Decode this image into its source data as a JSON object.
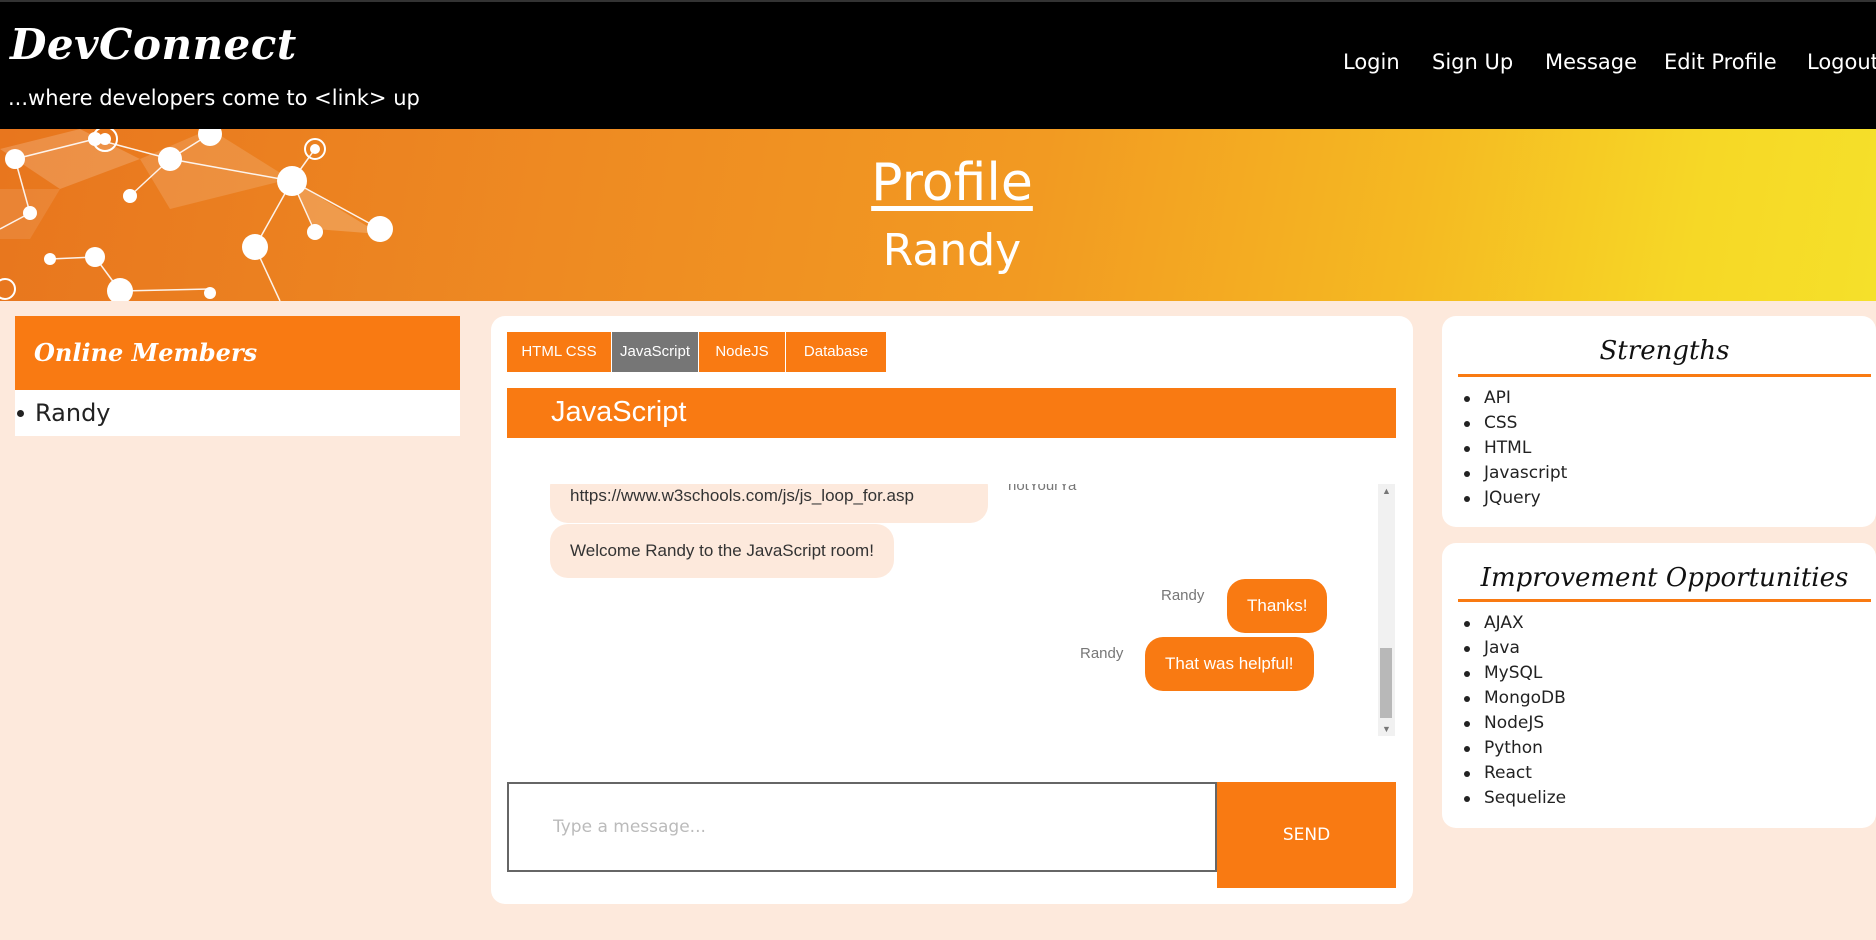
{
  "navbar": {
    "brand": "DevConnect",
    "tagline": "...where developers come to <link> up",
    "links": [
      {
        "label": "Login"
      },
      {
        "label": "Sign Up"
      },
      {
        "label": "Message"
      },
      {
        "label": "Edit Profile"
      },
      {
        "label": "Logout"
      }
    ]
  },
  "banner": {
    "title": "Profile",
    "name": "Randy"
  },
  "online_members": {
    "title": "Online Members",
    "members": [
      "Randy"
    ]
  },
  "chat": {
    "tabs": [
      {
        "label": "HTML CSS",
        "active": false
      },
      {
        "label": "JavaScript",
        "active": true
      },
      {
        "label": "NodeJS",
        "active": false
      },
      {
        "label": "Database",
        "active": false
      }
    ],
    "room_title": "JavaScript",
    "messages": [
      {
        "direction": "in",
        "text": "https://www.w3schools.com/js/js_loop_for.asp",
        "sender": "notYourYa"
      },
      {
        "direction": "in",
        "text": "Welcome Randy to the JavaScript room!",
        "sender": ""
      },
      {
        "direction": "out",
        "text": "Thanks!",
        "sender": "Randy"
      },
      {
        "direction": "out",
        "text": "That was helpful!",
        "sender": "Randy"
      }
    ],
    "input_placeholder": "Type a message...",
    "send_label": "SEND"
  },
  "strengths": {
    "title": "Strengths",
    "items": [
      "API",
      "CSS",
      "HTML",
      "Javascript",
      "JQuery"
    ]
  },
  "improvements": {
    "title": "Improvement Opportunities",
    "items": [
      "AJAX",
      "Java",
      "MySQL",
      "MongoDB",
      "NodeJS",
      "Python",
      "React",
      "Sequelize"
    ]
  },
  "colors": {
    "accent": "#f97a12",
    "page_background": "#fde9dc",
    "navbar": "#000000",
    "active_tab": "#767676"
  }
}
